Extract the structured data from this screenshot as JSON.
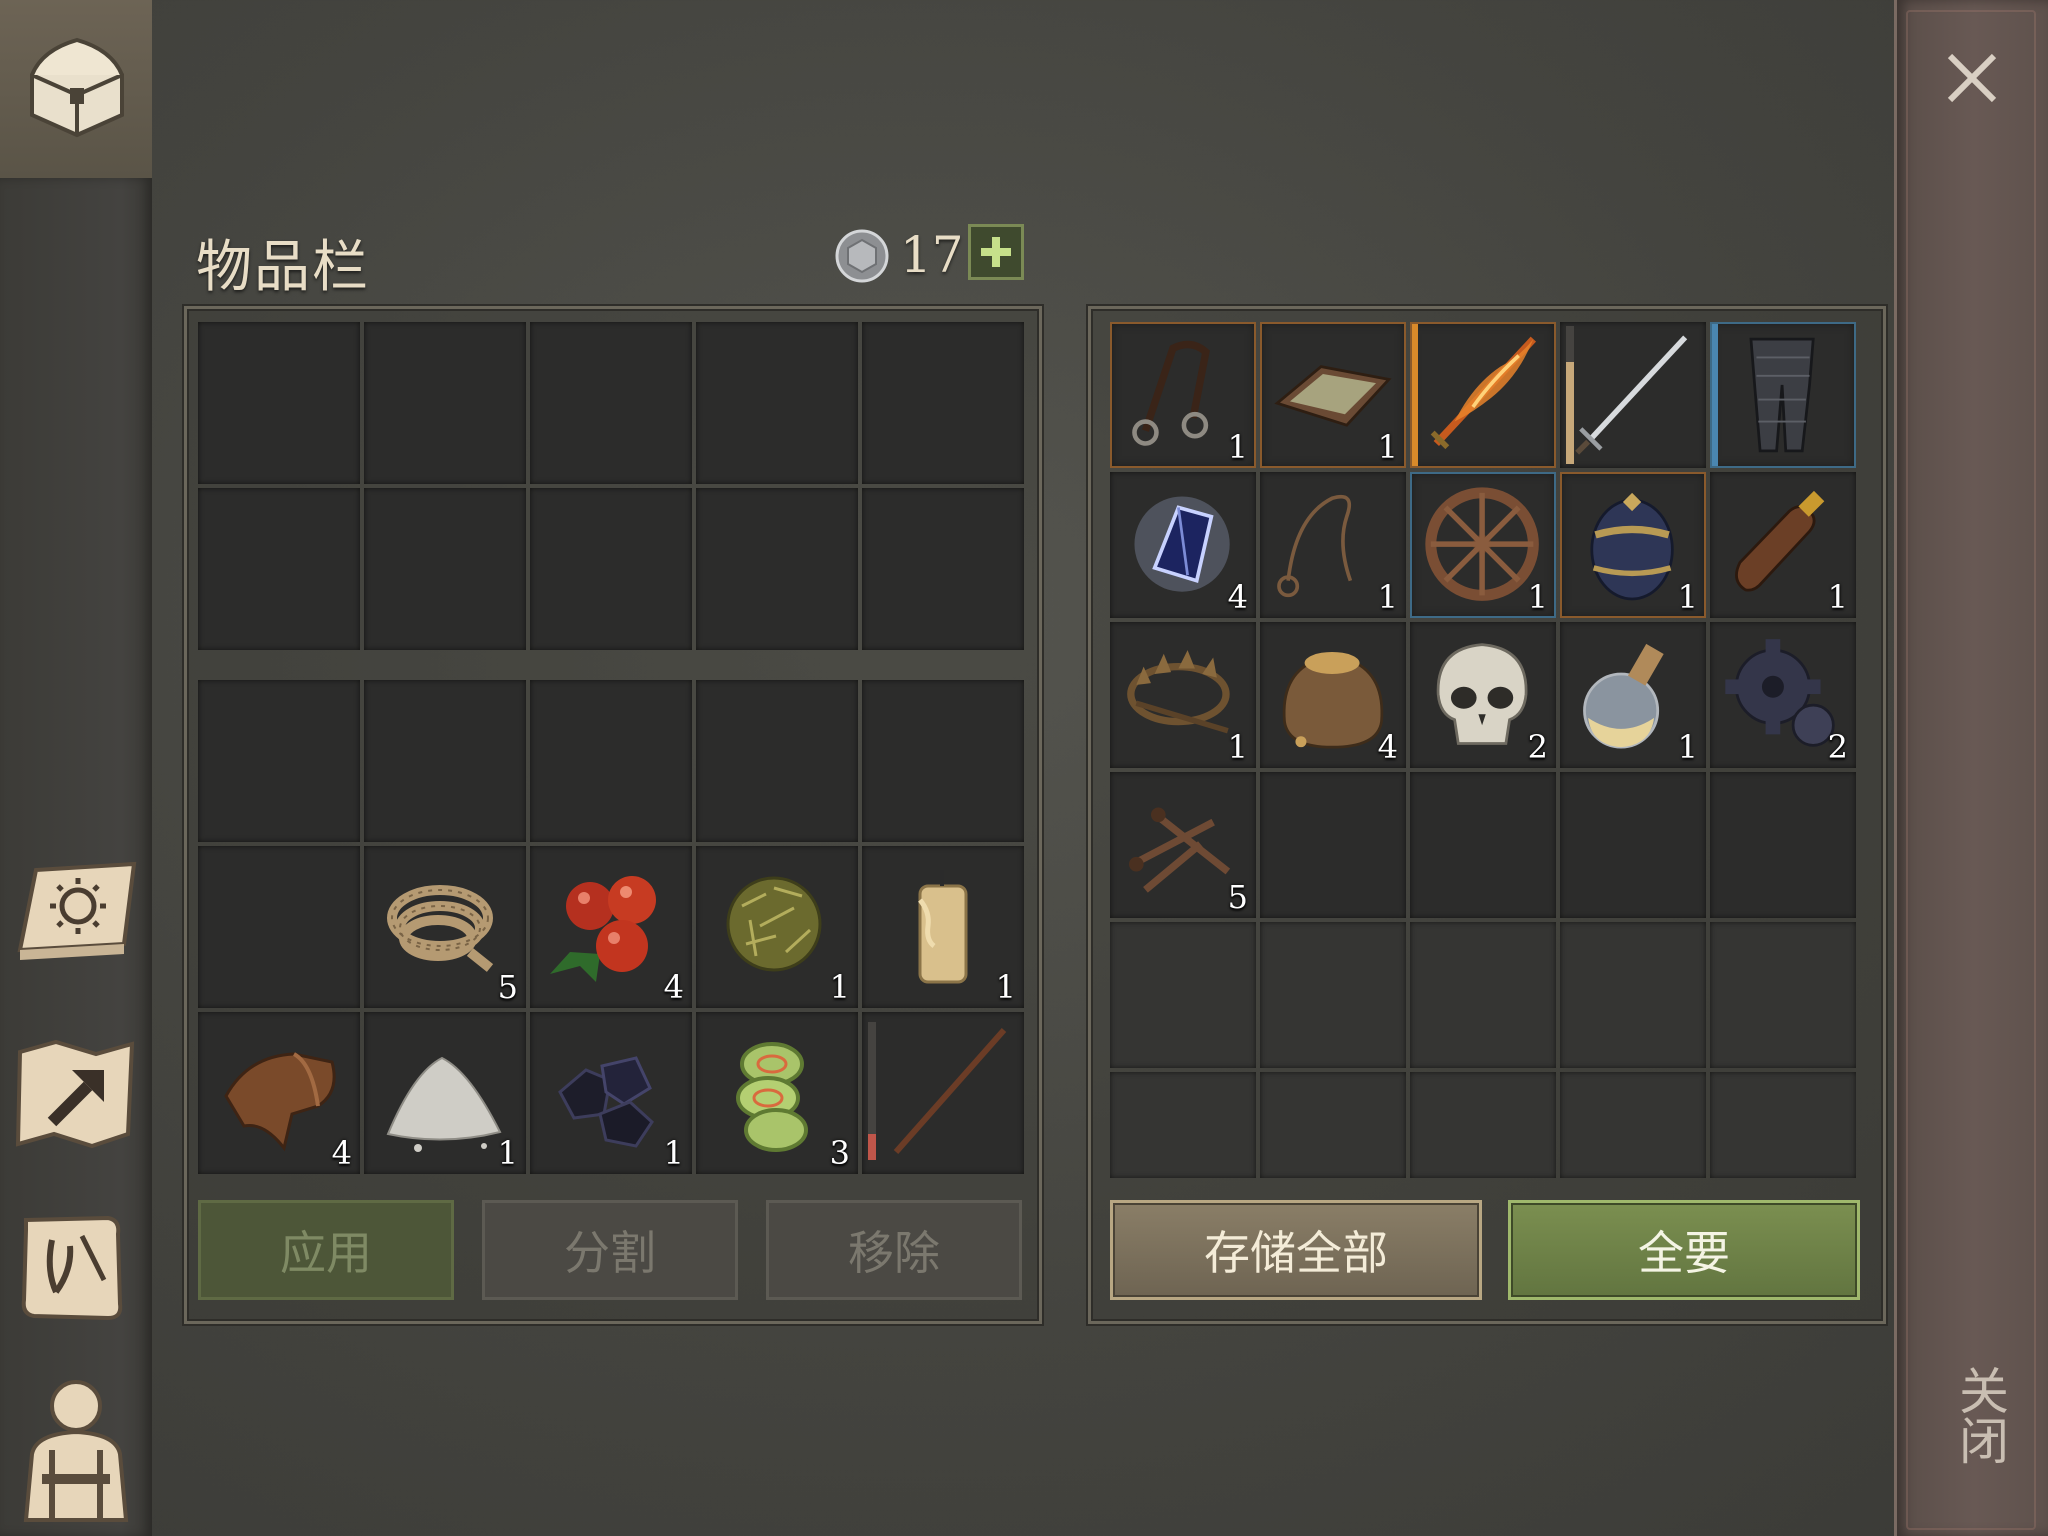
{
  "header": {
    "title": "物品栏",
    "coin_count": "17"
  },
  "close_label": "关闭",
  "inventory": {
    "top_rows": [
      [
        {
          "icon": "",
          "count": ""
        },
        {
          "icon": "",
          "count": ""
        },
        {
          "icon": "",
          "count": ""
        },
        {
          "icon": "",
          "count": ""
        },
        {
          "icon": "",
          "count": ""
        }
      ],
      [
        {
          "icon": "",
          "count": ""
        },
        {
          "icon": "",
          "count": ""
        },
        {
          "icon": "",
          "count": ""
        },
        {
          "icon": "",
          "count": ""
        },
        {
          "icon": "",
          "count": ""
        }
      ]
    ],
    "bottom_rows": [
      [
        {
          "icon": "",
          "count": ""
        },
        {
          "icon": "",
          "count": ""
        },
        {
          "icon": "",
          "count": ""
        },
        {
          "icon": "",
          "count": ""
        },
        {
          "icon": "",
          "count": ""
        }
      ],
      [
        {
          "icon": "",
          "count": ""
        },
        {
          "icon": "rope-icon",
          "count": "5"
        },
        {
          "icon": "berries-icon",
          "count": "4"
        },
        {
          "icon": "grass-ball-icon",
          "count": "1"
        },
        {
          "icon": "candle-icon",
          "count": "1"
        }
      ],
      [
        {
          "icon": "leather-icon",
          "count": "4"
        },
        {
          "icon": "salt-pile-icon",
          "count": "1"
        },
        {
          "icon": "coal-icon",
          "count": "1"
        },
        {
          "icon": "cucumber-slices-icon",
          "count": "3"
        },
        {
          "icon": "stick-icon",
          "count": ""
        }
      ]
    ]
  },
  "loot": {
    "rows": [
      [
        {
          "icon": "bridle-icon",
          "count": "1",
          "quality": "orange"
        },
        {
          "icon": "tray-icon",
          "count": "1",
          "quality": "orange"
        },
        {
          "icon": "flame-sword-icon",
          "count": "",
          "quality": "orange"
        },
        {
          "icon": "longsword-icon",
          "count": "",
          "quality": "none"
        },
        {
          "icon": "chain-leggings-icon",
          "count": "",
          "quality": "blue"
        }
      ],
      [
        {
          "icon": "crystal-icon",
          "count": "4",
          "quality": "none"
        },
        {
          "icon": "cord-icon",
          "count": "1",
          "quality": "none"
        },
        {
          "icon": "wheel-icon",
          "count": "1",
          "quality": "blue"
        },
        {
          "icon": "egg-icon",
          "count": "1",
          "quality": "orange"
        },
        {
          "icon": "bottle-icon",
          "count": "1",
          "quality": "none"
        }
      ],
      [
        {
          "icon": "bear-trap-icon",
          "count": "1",
          "quality": "none"
        },
        {
          "icon": "grain-sack-icon",
          "count": "4",
          "quality": "none"
        },
        {
          "icon": "skull-icon",
          "count": "2",
          "quality": "none"
        },
        {
          "icon": "potion-icon",
          "count": "1",
          "quality": "none"
        },
        {
          "icon": "gears-icon",
          "count": "2",
          "quality": "none"
        }
      ],
      [
        {
          "icon": "nails-icon",
          "count": "5",
          "quality": "none"
        },
        {
          "icon": "",
          "count": "",
          "quality": "none"
        },
        {
          "icon": "",
          "count": "",
          "quality": "none"
        },
        {
          "icon": "",
          "count": "",
          "quality": "none"
        },
        {
          "icon": "",
          "count": "",
          "quality": "none"
        }
      ]
    ]
  },
  "buttons": {
    "apply": "应用",
    "split": "分割",
    "remove": "移除",
    "store_all": "存储全部",
    "take_all": "全要"
  },
  "colors": {
    "quality_orange": "#8a5a2c",
    "quality_blue": "#3e6a86",
    "accent_green": "#7b8f50"
  }
}
